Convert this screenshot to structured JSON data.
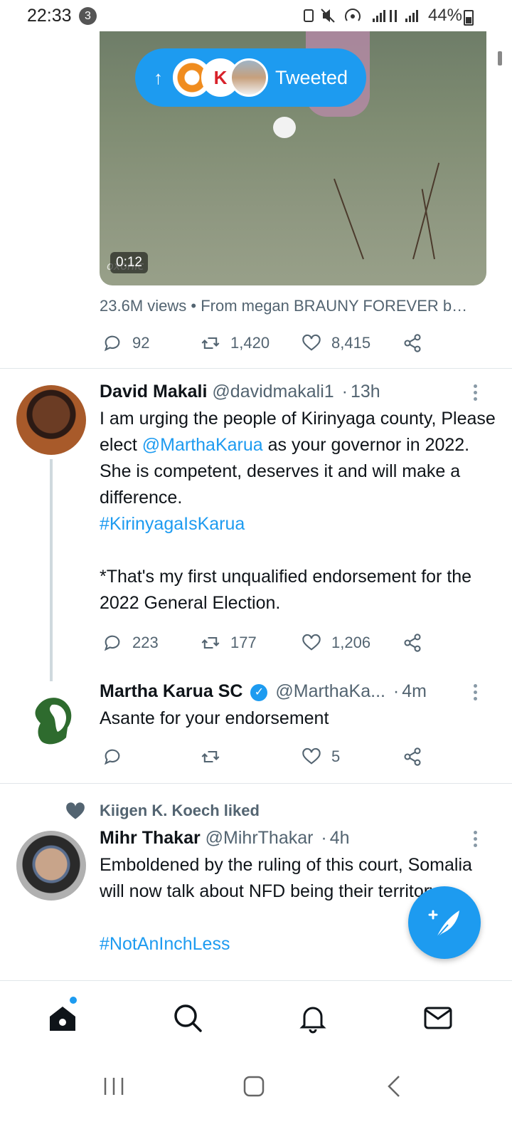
{
  "status_bar": {
    "time": "22:33",
    "notification_count": "3",
    "battery_percent": "44%"
  },
  "pill": {
    "label": "Tweeted",
    "avatar_2_text": "K"
  },
  "media": {
    "duration": "0:12",
    "watermark": "oxonic"
  },
  "top_tweet": {
    "meta": "23.6M views • From megan BRAUNY FOREVER b…",
    "replies": "92",
    "retweets": "1,420",
    "likes": "8,415"
  },
  "tweet_david": {
    "name": "David Makali",
    "handle": "@davidmakali1",
    "time": "13h",
    "text_1": "I am urging the people of Kirinyaga county, Please elect ",
    "mention": "@MarthaKarua",
    "text_2": " as your governor in 2022. She is competent, deserves it and will make a difference.",
    "hashtag": "#KirinyagaIsKarua",
    "text_3": "*That's my first unqualified endorsement for the 2022 General Election.",
    "replies": "223",
    "retweets": "177",
    "likes": "1,206"
  },
  "tweet_martha": {
    "name": "Martha Karua SC",
    "handle": "@MarthaKa...",
    "time": "4m",
    "text": "Asante for your endorsement",
    "likes": "5"
  },
  "tweet_mihr": {
    "liked_by": "Kiigen K. Koech liked",
    "name": "Mihr Thakar",
    "handle": "@MihrThakar",
    "time": "4h",
    "text": "Emboldened by the ruling of this court, Somalia will now talk about NFD being their territory.",
    "hashtag": "#NotAnInchLess"
  },
  "colors": {
    "accent": "#1d9bf0",
    "text": "#0f1419",
    "secondary": "#536471"
  },
  "icons": {
    "reply": "reply-icon",
    "retweet": "retweet-icon",
    "like": "heart-icon",
    "share": "share-icon",
    "home": "home-icon",
    "search": "search-icon",
    "notifications": "bell-icon",
    "messages": "mail-icon",
    "compose": "compose-icon"
  }
}
